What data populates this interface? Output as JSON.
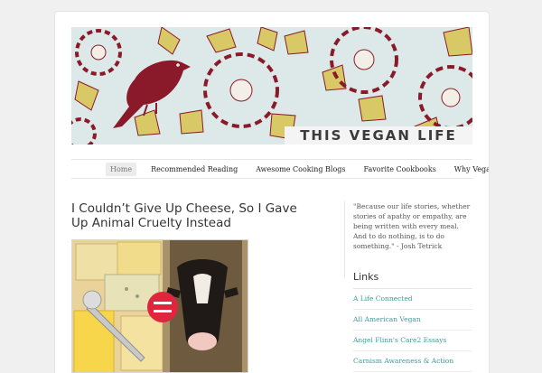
{
  "site": {
    "title": "THIS VEGAN LIFE"
  },
  "nav": {
    "items": [
      {
        "label": "Home",
        "active": true
      },
      {
        "label": "Recommended Reading"
      },
      {
        "label": "Awesome Cooking Blogs"
      },
      {
        "label": "Favorite Cookbooks"
      },
      {
        "label": "Why Vegan?"
      }
    ]
  },
  "post": {
    "title": "I Couldn’t Give Up Cheese, So I Gave Up Animal Cruelty Instead"
  },
  "sidebar": {
    "quote": "\"Because our life stories, whether stories of apathy or empathy, are being written with every meal. And to do nothing, is to do something.\" - Josh Tetrick",
    "links_title": "Links",
    "links": [
      "A Life Connected",
      "All American Vegan",
      "Angel Flinn's Care2 Essays",
      "Carnism Awareness & Action"
    ]
  },
  "colors": {
    "banner_bg": "#dde9e8",
    "flower_red": "#8a1a2a",
    "leaf_yellow": "#d8c866",
    "link_teal": "#3b9c9c",
    "badge_red": "#e0263d"
  }
}
